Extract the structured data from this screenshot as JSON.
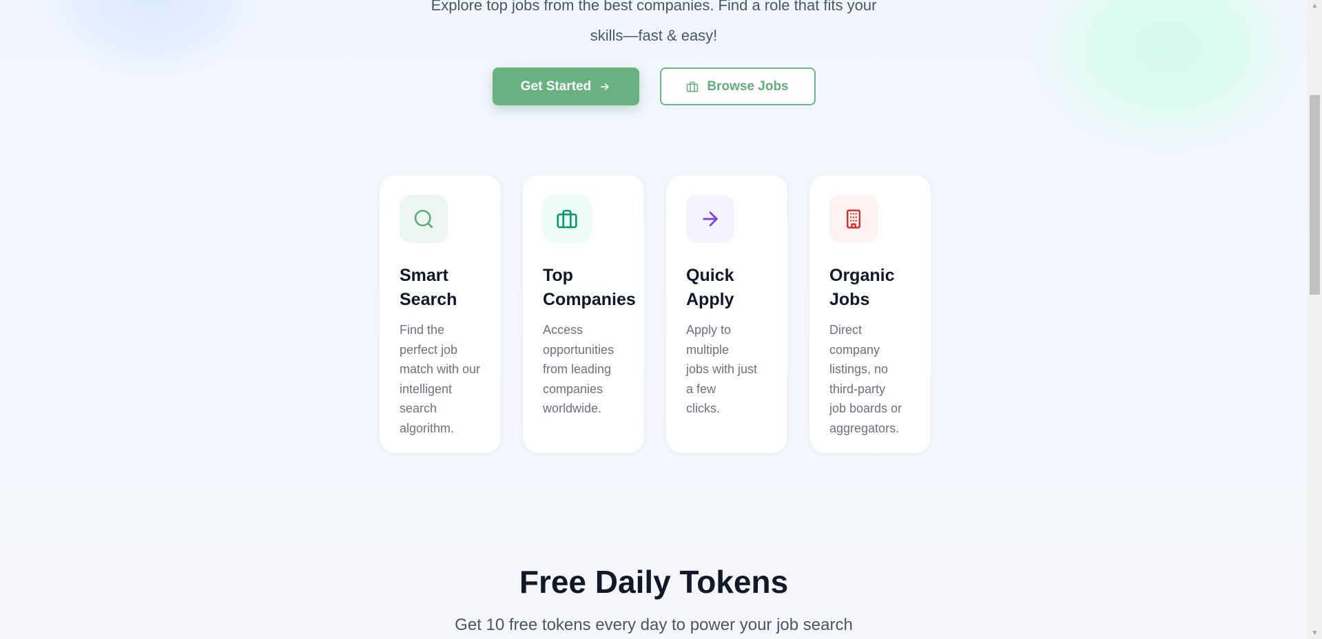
{
  "hero": {
    "subtitle_line1": "Explore top jobs from the best companies. Find a role that fits your",
    "subtitle_line2": "skills—fast & easy!",
    "primary_cta": "Get Started",
    "secondary_cta": "Browse Jobs"
  },
  "features": [
    {
      "icon": "search-icon",
      "title_line1": "Smart",
      "title_line2": "Search",
      "desc_lines": [
        "Find the",
        "perfect job",
        "match with our",
        "intelligent",
        "search",
        "algorithm."
      ],
      "icon_color": "#5aa977",
      "icon_bg": "#edf5f0"
    },
    {
      "icon": "briefcase-icon",
      "title_line1": "Top",
      "title_line2": "Companies",
      "desc_lines": [
        "Access",
        "opportunities",
        "from leading",
        "companies",
        "worldwide."
      ],
      "icon_color": "#059669",
      "icon_bg": "#ecfdf5"
    },
    {
      "icon": "arrow-right-icon",
      "title_line1": "Quick",
      "title_line2": "Apply",
      "desc_lines": [
        "Apply to",
        "multiple",
        "jobs with just",
        "a few",
        "clicks."
      ],
      "icon_color": "#7c3aed",
      "icon_bg": "#f5f3ff"
    },
    {
      "icon": "building-icon",
      "title_line1": "Organic",
      "title_line2": "Jobs",
      "desc_lines": [
        "Direct",
        "company",
        "listings, no",
        "third-party",
        "job boards or",
        "aggregators."
      ],
      "icon_color": "#dc2626",
      "icon_bg": "#fef2f2"
    }
  ],
  "tokens_section": {
    "title": "Free Daily Tokens",
    "subtitle": "Get 10 free tokens every day to power your job search"
  },
  "colors": {
    "primary_green": "#69b280",
    "outline_green": "#6bb584",
    "background": "#f3f6fd"
  }
}
